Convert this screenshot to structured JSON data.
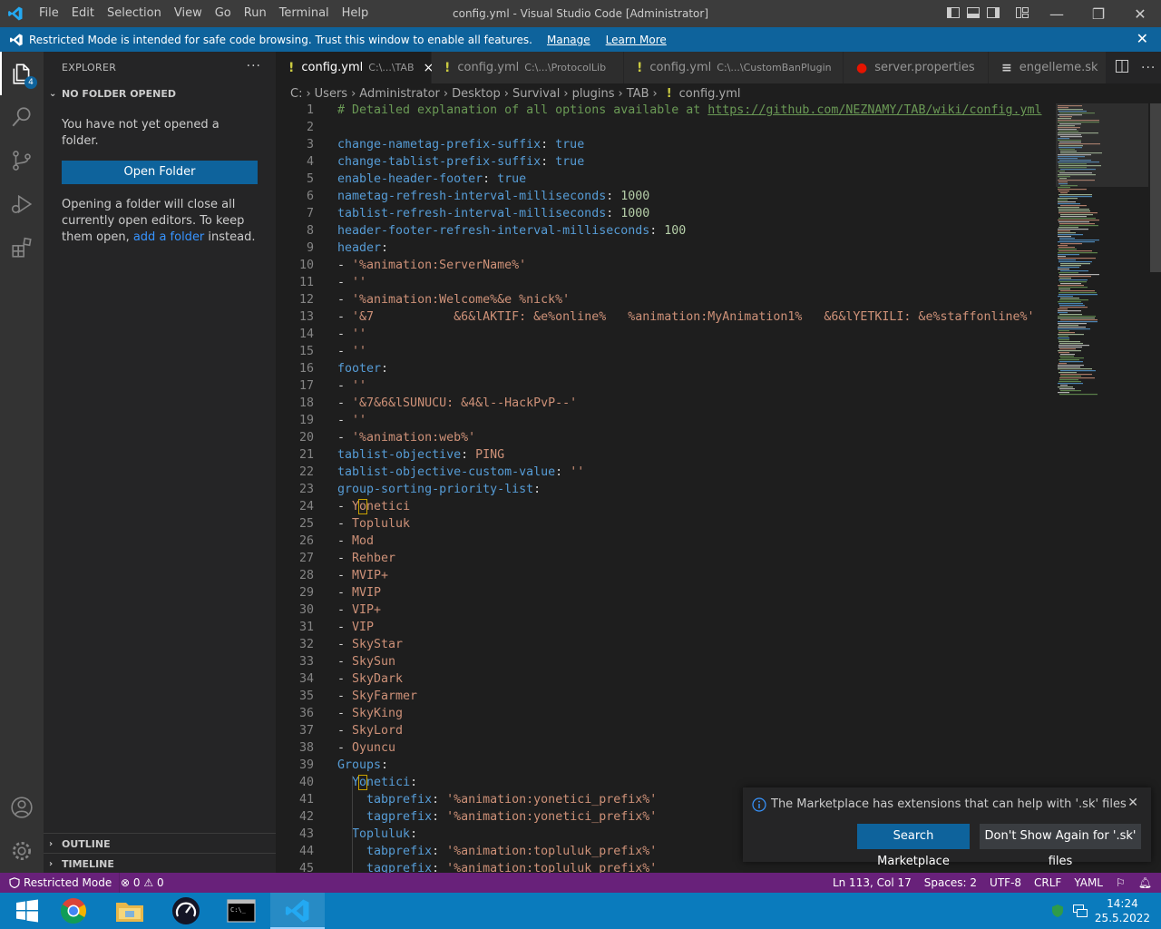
{
  "titlebar": {
    "menus": [
      "File",
      "Edit",
      "Selection",
      "View",
      "Go",
      "Run",
      "Terminal",
      "Help"
    ],
    "title": "config.yml - Visual Studio Code [Administrator]"
  },
  "banner": {
    "text": "Restricted Mode is intended for safe code browsing. Trust this window to enable all features.",
    "manage": "Manage",
    "learn_more": "Learn More"
  },
  "activity": {
    "explorer_badge": "4"
  },
  "sidebar": {
    "header": "EXPLORER",
    "section": "NO FOLDER OPENED",
    "no_folder_text": "You have not yet opened a folder.",
    "open_folder": "Open Folder",
    "info_before": "Opening a folder will close all currently open editors. To keep them open, ",
    "info_link": "add a folder",
    "info_after": " instead.",
    "outline": "OUTLINE",
    "timeline": "TIMELINE"
  },
  "tabs": [
    {
      "icon": "!",
      "label": "config.yml",
      "path": "C:\\...\\TAB",
      "active": true,
      "icon_color": "#cbcb41"
    },
    {
      "icon": "!",
      "label": "config.yml",
      "path": "C:\\...\\ProtocolLib",
      "active": false,
      "icon_color": "#cbcb41"
    },
    {
      "icon": "!",
      "label": "config.yml",
      "path": "C:\\...\\CustomBanPlugin",
      "active": false,
      "icon_color": "#cbcb41"
    },
    {
      "icon": "●",
      "label": "server.properties",
      "path": "",
      "active": false,
      "icon_color": "#e51400"
    },
    {
      "icon": "≡",
      "label": "engelleme.sk",
      "path": "",
      "active": false,
      "icon_color": "#cccccc"
    }
  ],
  "breadcrumb": [
    "C:",
    "Users",
    "Administrator",
    "Desktop",
    "Survival",
    "plugins",
    "TAB",
    "config.yml"
  ],
  "editor": {
    "lines": [
      {
        "n": "1",
        "html": "<span class='c'># Detailed explanation of all options available at </span><span class='u'>https://github.com/NEZNAMY/TAB/wiki/config.yml</span>"
      },
      {
        "n": "2",
        "html": ""
      },
      {
        "n": "3",
        "html": "<span class='k'>change-nametag-prefix-suffix</span>: <span class='k'>true</span>"
      },
      {
        "n": "4",
        "html": "<span class='k'>change-tablist-prefix-suffix</span>: <span class='k'>true</span>"
      },
      {
        "n": "5",
        "html": "<span class='k'>enable-header-footer</span>: <span class='k'>true</span>"
      },
      {
        "n": "6",
        "html": "<span class='k'>nametag-refresh-interval-milliseconds</span>: <span class='n'>1000</span>"
      },
      {
        "n": "7",
        "html": "<span class='k'>tablist-refresh-interval-milliseconds</span>: <span class='n'>1000</span>"
      },
      {
        "n": "8",
        "html": "<span class='k'>header-footer-refresh-interval-milliseconds</span>: <span class='n'>100</span>"
      },
      {
        "n": "9",
        "html": "<span class='k'>header</span>:"
      },
      {
        "n": "10",
        "html": "- <span class='s'>'%animation:ServerName%'</span>"
      },
      {
        "n": "11",
        "html": "- <span class='s'>''</span>"
      },
      {
        "n": "12",
        "html": "- <span class='s'>'%animation:Welcome%&amp;e %nick%'</span>"
      },
      {
        "n": "13",
        "html": "- <span class='s'>'&amp;7           &amp;6&amp;lAKTIF: &amp;e%online%   %animation:MyAnimation1%   &amp;6&amp;lYETKILI: &amp;e%staffonline%'</span>"
      },
      {
        "n": "14",
        "html": "- <span class='s'>''</span>"
      },
      {
        "n": "15",
        "html": "- <span class='s'>''</span>"
      },
      {
        "n": "16",
        "html": "<span class='k'>footer</span>:"
      },
      {
        "n": "17",
        "html": "- <span class='s'>''</span>"
      },
      {
        "n": "18",
        "html": "- <span class='s'>'&amp;7&amp;6&amp;lSUNUCU: &amp;4&amp;l--HackPvP--'</span>"
      },
      {
        "n": "19",
        "html": "- <span class='s'>''</span>"
      },
      {
        "n": "20",
        "html": "- <span class='s'>'%animation:web%'</span>"
      },
      {
        "n": "21",
        "html": "<span class='k'>tablist-objective</span>: <span class='s'>PING</span>"
      },
      {
        "n": "22",
        "html": "<span class='k'>tablist-objective-custom-value</span>: <span class='s'>''</span>"
      },
      {
        "n": "23",
        "html": "<span class='k'>group-sorting-priority-list</span>:"
      },
      {
        "n": "24",
        "html": "- <span class='s'>Y<span class='cur'>o</span>netici</span>"
      },
      {
        "n": "25",
        "html": "- <span class='s'>Topluluk</span>"
      },
      {
        "n": "26",
        "html": "- <span class='s'>Mod</span>"
      },
      {
        "n": "27",
        "html": "- <span class='s'>Rehber</span>"
      },
      {
        "n": "28",
        "html": "- <span class='s'>MVIP+</span>"
      },
      {
        "n": "29",
        "html": "- <span class='s'>MVIP</span>"
      },
      {
        "n": "30",
        "html": "- <span class='s'>VIP+</span>"
      },
      {
        "n": "31",
        "html": "- <span class='s'>VIP</span>"
      },
      {
        "n": "32",
        "html": "- <span class='s'>SkyStar</span>"
      },
      {
        "n": "33",
        "html": "- <span class='s'>SkySun</span>"
      },
      {
        "n": "34",
        "html": "- <span class='s'>SkyDark</span>"
      },
      {
        "n": "35",
        "html": "- <span class='s'>SkyFarmer</span>"
      },
      {
        "n": "36",
        "html": "- <span class='s'>SkyKing</span>"
      },
      {
        "n": "37",
        "html": "- <span class='s'>SkyLord</span>"
      },
      {
        "n": "38",
        "html": "- <span class='s'>Oyuncu</span>"
      },
      {
        "n": "39",
        "html": "<span class='k'>Groups</span>:"
      },
      {
        "n": "40",
        "html": "  <span class='k'>Y<span class='cur'>o</span>netici</span>:"
      },
      {
        "n": "41",
        "html": "    <span class='k'>tabprefix</span>: <span class='s'>'%animation:yonetici_prefix%'</span>"
      },
      {
        "n": "42",
        "html": "    <span class='k'>tagprefix</span>: <span class='s'>'%animation:yonetici_prefix%'</span>"
      },
      {
        "n": "43",
        "html": "  <span class='k'>Topluluk</span>:"
      },
      {
        "n": "44",
        "html": "    <span class='k'>tabprefix</span>: <span class='s'>'%animation:topluluk_prefix%'</span>"
      },
      {
        "n": "45",
        "html": "    <span class='k'>tagprefix</span>: <span class='s'>'%animation:topluluk_prefix%'</span>"
      }
    ]
  },
  "notification": {
    "message": "The Marketplace has extensions that can help with '.sk' files",
    "primary": "Search Marketplace",
    "secondary": "Don't Show Again for '.sk' files"
  },
  "statusbar": {
    "restricted": "Restricted Mode",
    "errors": "0",
    "warnings": "0",
    "position": "Ln 113, Col 17",
    "spaces": "Spaces: 2",
    "encoding": "UTF-8",
    "eol": "CRLF",
    "language": "YAML"
  },
  "taskbar": {
    "time": "14:24",
    "date": "25.5.2022"
  },
  "colors": {
    "accent": "#0e639c",
    "statusbar": "#68217a",
    "taskbar": "#0a7bbd"
  }
}
